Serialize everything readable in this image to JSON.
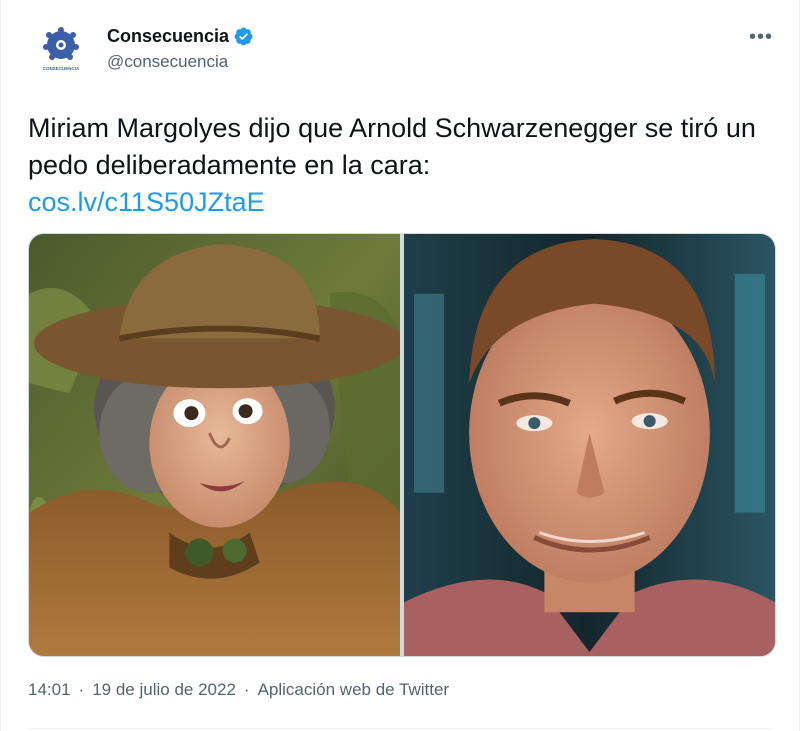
{
  "author": {
    "display_name": "Consecuencia",
    "handle": "@consecuencia",
    "avatar_caption": "CONSECUENCIA",
    "verified": true
  },
  "tweet": {
    "text_line": "Miriam Margolyes dijo que Arnold Schwarzenegger se tiró un pedo deliberadamente en la cara:",
    "link": "cos.lv/c11S50JZtaE"
  },
  "meta": {
    "time": "14:01",
    "separator": "·",
    "date": "19 de julio de 2022",
    "source": "Aplicación web de Twitter"
  },
  "icons": {
    "more": "more-icon",
    "verified": "verified-badge-icon"
  },
  "colors": {
    "link": "#1d9bf0",
    "secondary_text": "#536471",
    "verified": "#1d9bf0"
  }
}
